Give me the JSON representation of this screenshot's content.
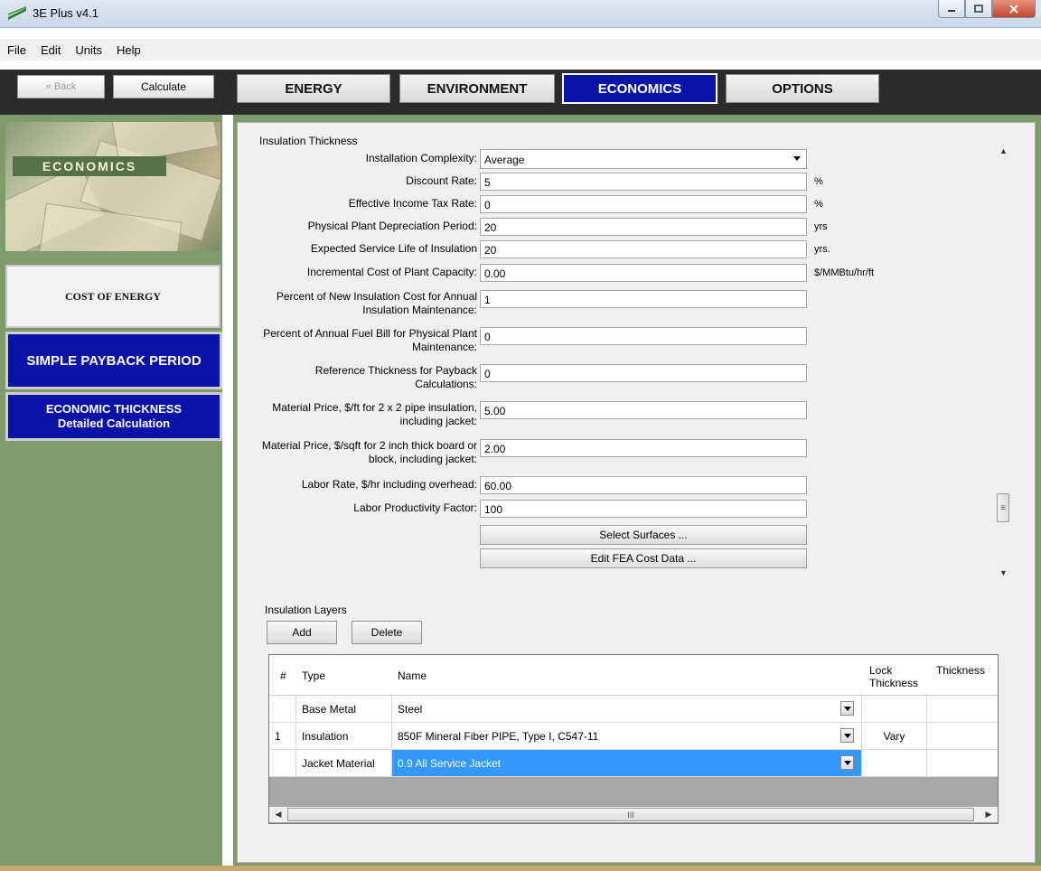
{
  "window": {
    "title": "3E Plus v4.1"
  },
  "menu": [
    "File",
    "Edit",
    "Units",
    "Help"
  ],
  "toolbar": {
    "back_label": "« Back",
    "calculate_label": "Calculate"
  },
  "tabs": [
    {
      "label": "ENERGY",
      "active": false
    },
    {
      "label": "ENVIRONMENT",
      "active": false
    },
    {
      "label": "ECONOMICS",
      "active": true
    },
    {
      "label": "OPTIONS",
      "active": false
    }
  ],
  "sidebar": {
    "banner_label": "ECONOMICS",
    "cost_of_energy": "COST OF ENERGY",
    "simple_payback": "SIMPLE PAYBACK PERIOD",
    "econ_thickness_line1": "ECONOMIC THICKNESS",
    "econ_thickness_line2": "Detailed Calculation"
  },
  "insulation_thickness": {
    "group_title": "Insulation Thickness",
    "complexity": {
      "label": "Installation Complexity:",
      "value": "Average"
    },
    "fields": [
      {
        "label": "Discount Rate:",
        "value": "5",
        "unit": "%"
      },
      {
        "label": "Effective Income Tax Rate:",
        "value": "0",
        "unit": "%"
      },
      {
        "label": "Physical Plant Depreciation Period:",
        "value": "20",
        "unit": "yrs"
      },
      {
        "label": "Expected Service Life of Insulation",
        "value": "20",
        "unit": "yrs."
      },
      {
        "label": "Incremental Cost of Plant Capacity:",
        "value": "0.00",
        "unit": "$/MMBtu/hr/ft"
      },
      {
        "label": "Percent of New Insulation Cost for Annual Insulation Maintenance:",
        "value": "1",
        "unit": ""
      },
      {
        "label": "Percent of Annual Fuel Bill for Physical Plant Maintenance:",
        "value": "0",
        "unit": ""
      },
      {
        "label": "Reference Thickness for Payback Calculations:",
        "value": "0",
        "unit": ""
      },
      {
        "label": "Material Price, $/ft for 2 x 2 pipe insulation, including jacket:",
        "value": "5.00",
        "unit": ""
      },
      {
        "label": "Material Price, $/sqft for 2 inch thick board or block, including jacket:",
        "value": "2.00",
        "unit": ""
      },
      {
        "label": "Labor Rate, $/hr including overhead:",
        "value": "60.00",
        "unit": ""
      },
      {
        "label": "Labor Productivity Factor:",
        "value": "100",
        "unit": ""
      }
    ],
    "select_surfaces": "Select Surfaces ...",
    "edit_fea": "Edit FEA Cost Data ..."
  },
  "layers": {
    "title": "Insulation Layers",
    "add_label": "Add",
    "delete_label": "Delete",
    "headers": {
      "num": "#",
      "type": "Type",
      "name": "Name",
      "lock1": "Lock",
      "lock2": "Thickness",
      "thickness": "Thickness"
    },
    "rows": [
      {
        "num": "",
        "type": "Base Metal",
        "name": "Steel",
        "lock": ""
      },
      {
        "num": "1",
        "type": "Insulation",
        "name": "850F Mineral Fiber PIPE, Type I, C547-11",
        "lock": "Vary"
      },
      {
        "num": "",
        "type": "Jacket Material",
        "name": "0.9 All Service Jacket",
        "lock": ""
      }
    ],
    "scroll_grip": "III"
  }
}
